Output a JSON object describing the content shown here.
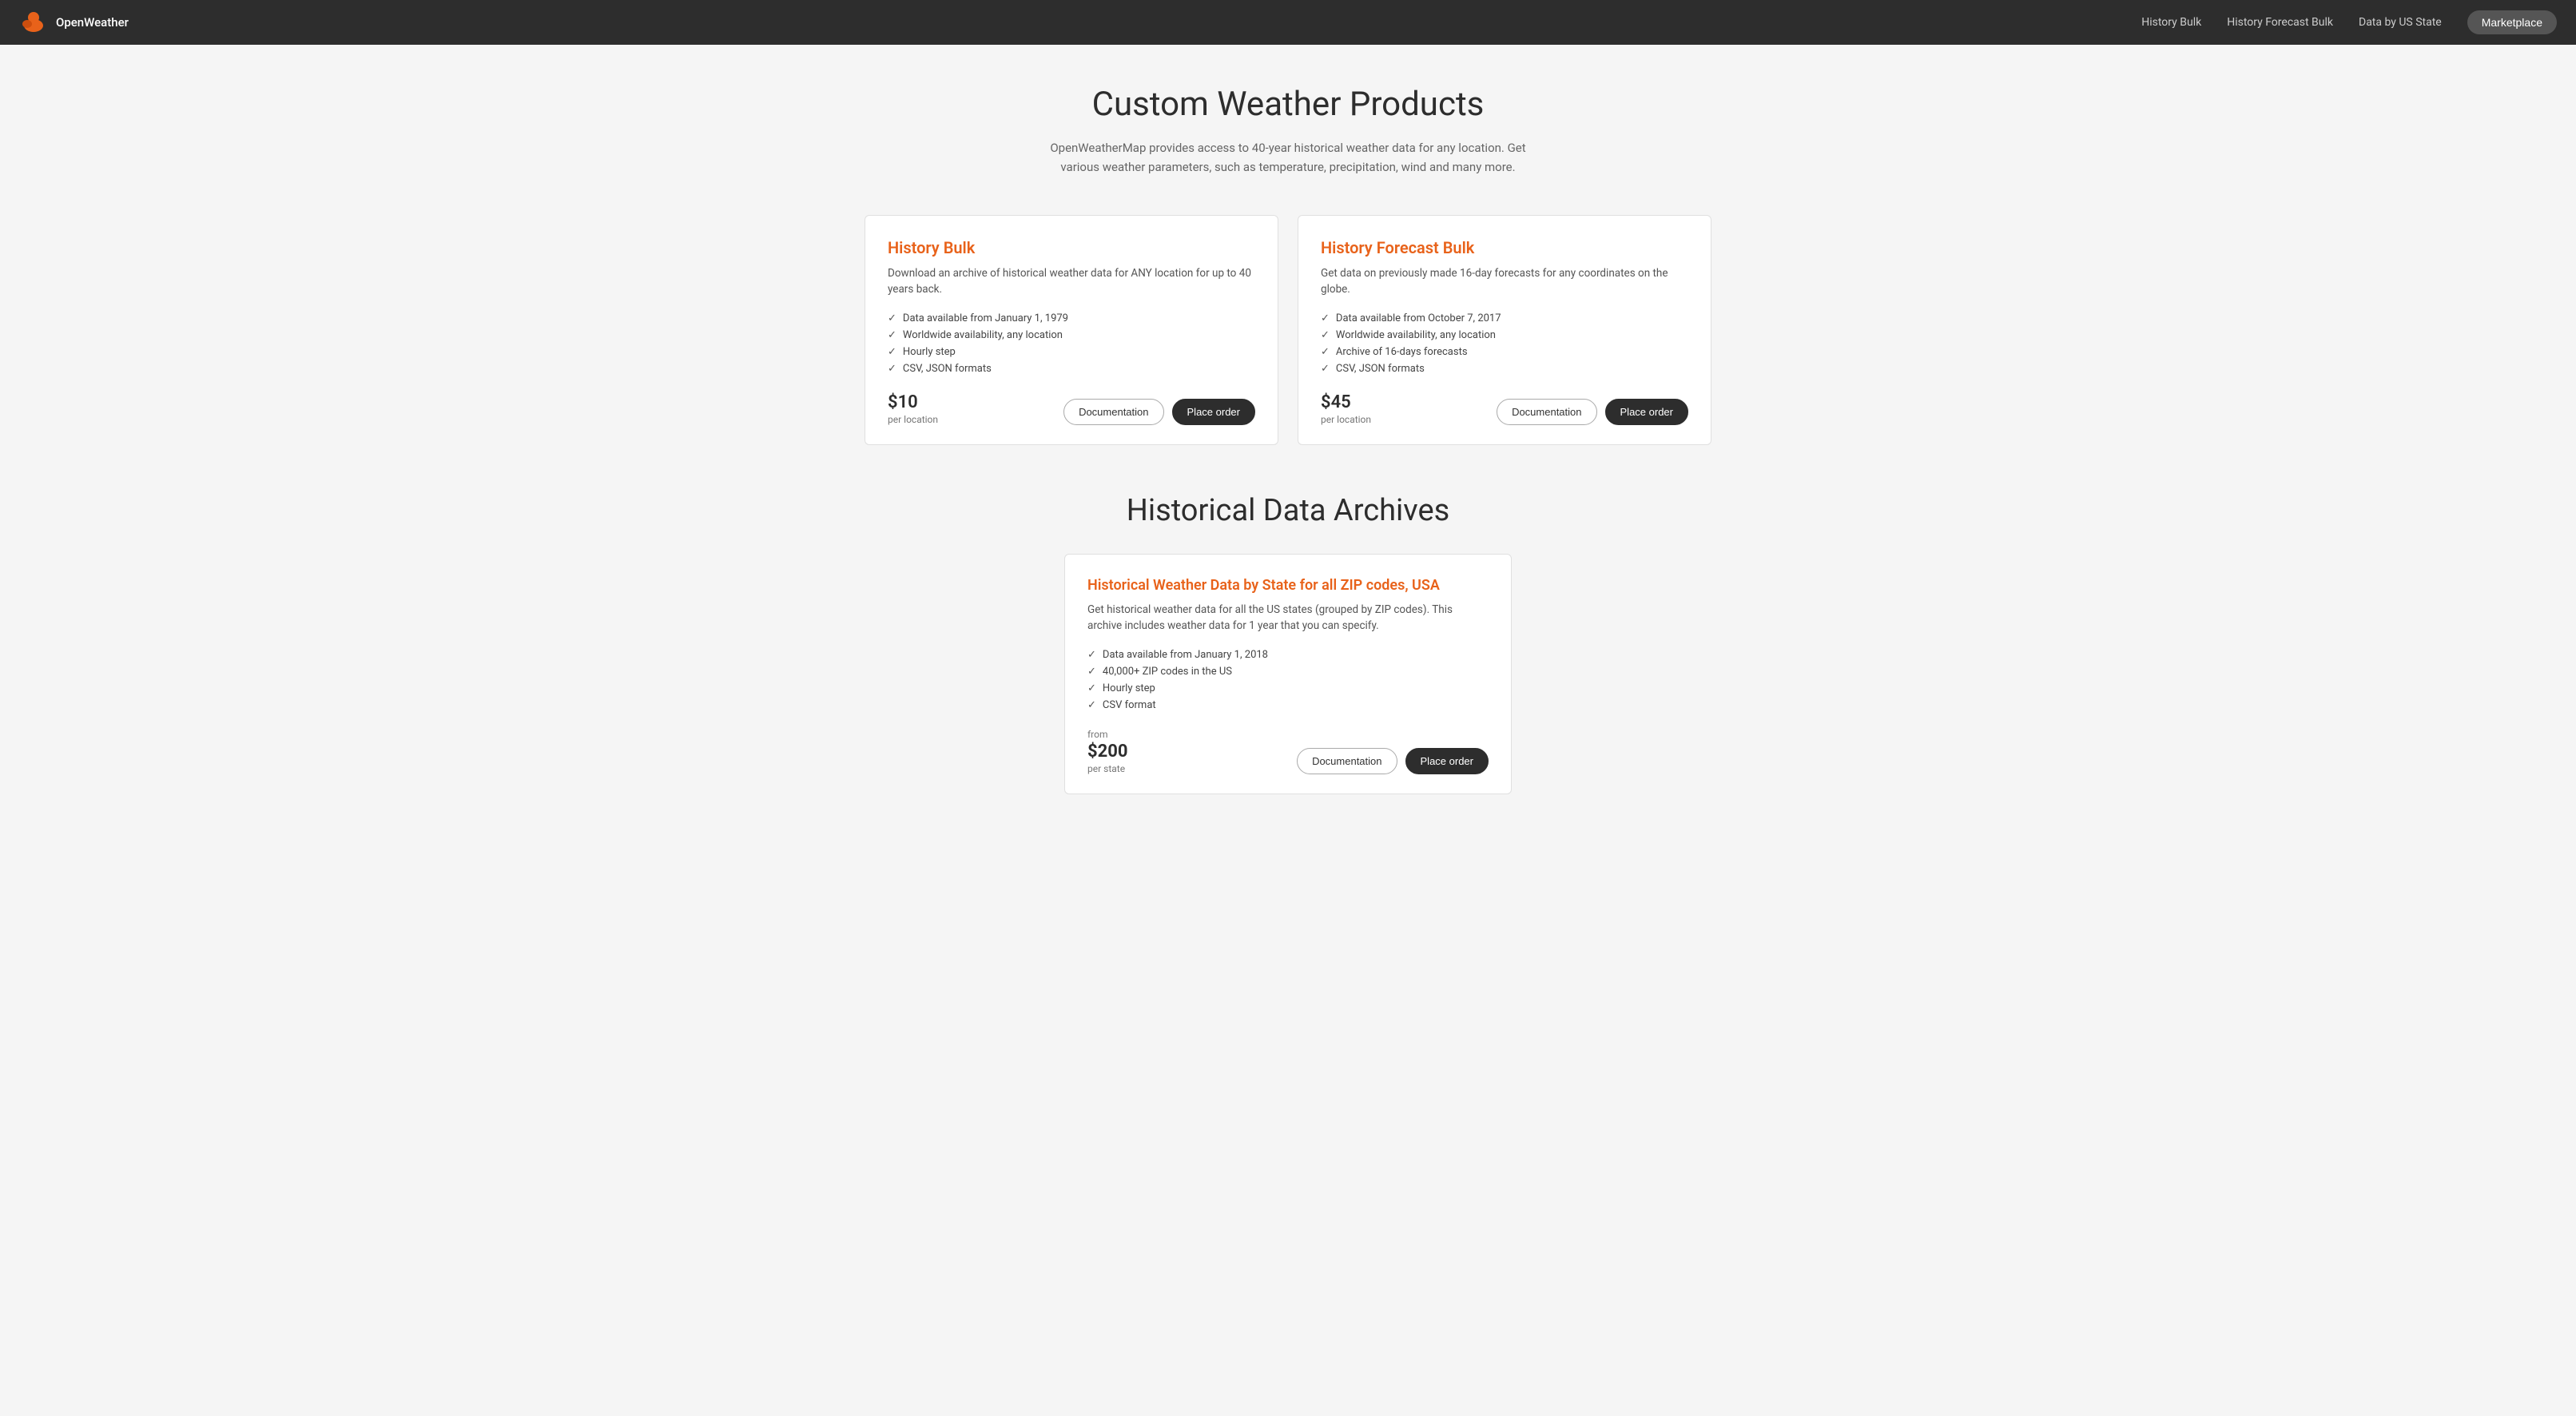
{
  "navbar": {
    "brand": "OpenWeather",
    "links": [
      {
        "id": "history-bulk",
        "label": "History Bulk"
      },
      {
        "id": "history-forecast-bulk",
        "label": "History Forecast Bulk"
      },
      {
        "id": "data-by-us-state",
        "label": "Data by US State"
      }
    ],
    "marketplace_button": "Marketplace"
  },
  "hero": {
    "title": "Custom Weather Products",
    "subtitle": "OpenWeatherMap provides access to 40-year historical weather data for any location. Get various weather parameters, such as temperature, precipitation, wind and many more."
  },
  "products": [
    {
      "id": "history-bulk",
      "title": "History Bulk",
      "description": "Download an archive of historical weather data for ANY location for up to 40 years back.",
      "features": [
        "Data available from January 1, 1979",
        "Worldwide availability, any location",
        "Hourly step",
        "CSV, JSON formats"
      ],
      "price": "$10",
      "price_label": "per location",
      "btn_documentation": "Documentation",
      "btn_order": "Place order"
    },
    {
      "id": "history-forecast-bulk",
      "title": "History Forecast Bulk",
      "description": "Get data on previously made 16-day forecasts for any coordinates on the globe.",
      "features": [
        "Data available from October 7, 2017",
        "Worldwide availability, any location",
        "Archive of 16-days forecasts",
        "CSV, JSON formats"
      ],
      "price": "$45",
      "price_label": "per location",
      "btn_documentation": "Documentation",
      "btn_order": "Place order"
    }
  ],
  "archives": {
    "section_title": "Historical Data Archives",
    "items": [
      {
        "id": "historical-weather-by-state",
        "title": "Historical Weather Data by State for all ZIP codes, USA",
        "description": "Get historical weather data for all the US states (grouped by ZIP codes). This archive includes weather data for 1 year that you can specify.",
        "features": [
          "Data available from January 1, 2018",
          "40,000+ ZIP codes in the US",
          "Hourly step",
          "CSV format"
        ],
        "price_from_label": "from",
        "price": "$200",
        "price_label": "per state",
        "btn_documentation": "Documentation",
        "btn_order": "Place order"
      }
    ]
  },
  "icons": {
    "check": "✓",
    "cloud": "☁"
  }
}
